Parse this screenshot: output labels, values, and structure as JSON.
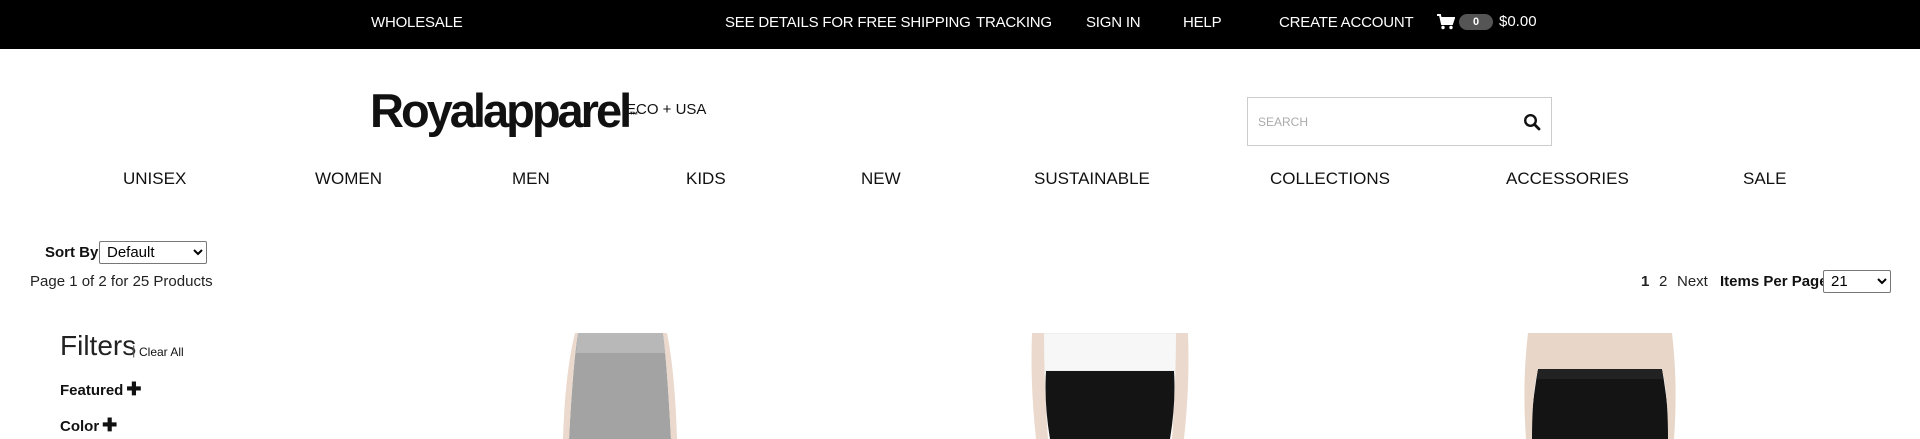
{
  "topbar": {
    "wholesale": "WHOLESALE",
    "shipping": "SEE DETAILS FOR FREE SHIPPING",
    "tracking": "TRACKING",
    "sign_in": "SIGN IN",
    "help": "HELP",
    "create_account": "CREATE ACCOUNT",
    "cart_count": "0",
    "cart_total": "$0.00",
    "cart_icon": "shopping-cart-icon"
  },
  "header": {
    "logo_text": "Royalapparel",
    "logo_tm": "™",
    "logo_sub": "ECO + USA",
    "search_placeholder": "SEARCH",
    "search_icon": "search-icon"
  },
  "nav": {
    "items": [
      "UNISEX",
      "WOMEN",
      "MEN",
      "KIDS",
      "NEW",
      "SUSTAINABLE",
      "COLLECTIONS",
      "ACCESSORIES",
      "SALE"
    ]
  },
  "listing": {
    "sort_label": "Sort By:",
    "sort_value": "Default",
    "page_info": "Page 1 of 2 for 25 Products",
    "pages": [
      "1",
      "2"
    ],
    "next": "Next",
    "items_per_page_label": "Items Per Page:",
    "items_per_page_value": "21"
  },
  "filters": {
    "title": "Filters",
    "separator": "|",
    "clear_all": "Clear All",
    "groups": [
      "Featured",
      "Color"
    ],
    "expand_icon": "plus-icon"
  },
  "colors": {
    "topbar_bg": "#000000",
    "text": "#111111",
    "product_grey": "#9e9e9e",
    "product_black": "#141414"
  }
}
